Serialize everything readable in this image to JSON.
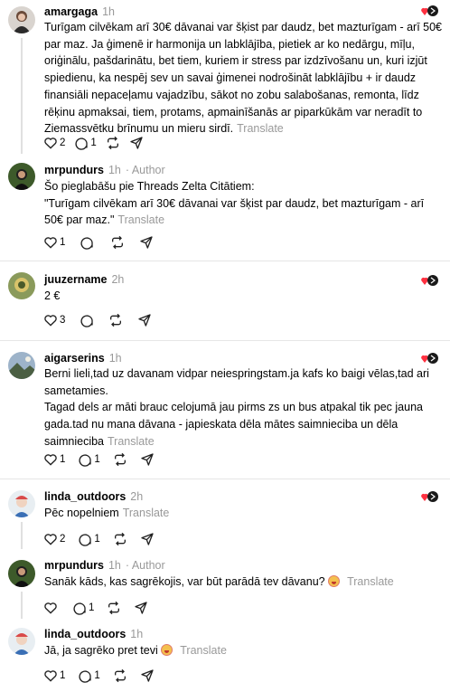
{
  "posts": [
    {
      "username": "amargaga",
      "time": "1h",
      "author": "",
      "text": "Turīgam cilvēkam arī 30€ dāvanai var šķist par daudz, bet mazturīgam - arī 50€ par maz. Ja ģimenē ir harmonija un labklājība, pietiek ar ko nedārgu, mīļu, oriģinālu, pašdarinātu, bet tiem, kuriem ir stress par izdzīvošanu un, kuri izjūt spiedienu, ka nespēj sev un savai ģimenei nodrošināt labklājību + ir daudz finansiāli nepaceļamu vajadzību, sākot no zobu salabošanas, remonta, līdz rēķinu apmaksai, tiem, protams, apmainīšanās ar piparkūkām var neradīt to Ziemassvētku brīnumu un mieru sirdī.",
      "translate": "Translate",
      "likes": "2",
      "replies": "1"
    },
    {
      "username": "mrpundurs",
      "time": "1h",
      "author": "· Author",
      "text": "Šo pieglabāšu pie Threads Zelta Citātiem:\n\"Turīgam cilvēkam arī 30€ dāvanai var šķist par daudz, bet mazturīgam - arī 50€ par maz.\"",
      "translate": "Translate",
      "likes": "1",
      "replies": ""
    },
    {
      "username": "juuzername",
      "time": "2h",
      "author": "",
      "text": "2 €",
      "translate": "",
      "likes": "3",
      "replies": ""
    },
    {
      "username": "aigarserins",
      "time": "1h",
      "author": "",
      "text": "Berni lieli,tad uz davanam vidpar neiespringstam.ja kafs ko baigi vēlas,tad ari sametamies.\nTagad dels ar māti brauc celojumā jau pirms zs un bus atpakal tik pec jauna gada.tad nu mana dāvana - japieskata dēla mātes saimnieciba un dēla saimnieciba",
      "translate": "Translate",
      "likes": "1",
      "replies": "1"
    },
    {
      "username": "linda_outdoors",
      "time": "2h",
      "author": "",
      "text": "Pēc nopelniem",
      "translate": "Translate",
      "likes": "2",
      "replies": "1"
    },
    {
      "username": "mrpundurs",
      "time": "1h",
      "author": "· Author",
      "text": "Sanāk kāds, kas sagrēkojis, var būt parādā tev dāvanu?",
      "translate": "Translate",
      "likes": "",
      "replies": "1"
    },
    {
      "username": "linda_outdoors",
      "time": "1h",
      "author": "",
      "text": "Jā, ja sagrēko pret tevi",
      "translate": "Translate",
      "likes": "1",
      "replies": "1"
    }
  ],
  "icons": {
    "like": "heart-icon",
    "reply": "comment-icon",
    "repost": "repost-icon",
    "share": "send-icon",
    "badge": "like-badge-icon"
  },
  "colors": {
    "badge_heart": "#ff3040",
    "muted": "#999999"
  }
}
